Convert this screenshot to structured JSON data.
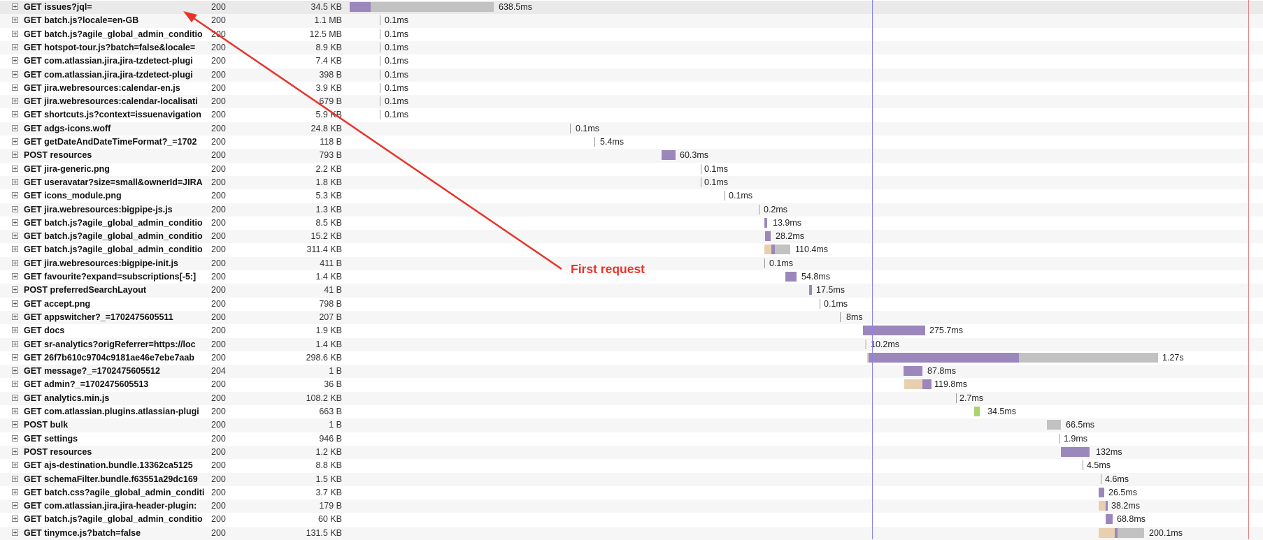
{
  "colors": {
    "waiting": "#9b87bb",
    "receiving": "#c2c2c2",
    "blocked": "#e8cfb0",
    "green": "#a9d36e",
    "dom_line": "#8c84e6",
    "load_line": "#e07a7a",
    "annotation": "#e8332a"
  },
  "annotation": {
    "text": "First request"
  },
  "requests": [
    {
      "url": "GET issues?jql=",
      "status": "200",
      "size": "34.5 KB",
      "time": "638.5ms"
    },
    {
      "url": "GET batch.js?locale=en-GB",
      "status": "200",
      "size": "1.1 MB",
      "time": "0.1ms"
    },
    {
      "url": "GET batch.js?agile_global_admin_conditio",
      "status": "200",
      "size": "12.5 MB",
      "time": "0.1ms"
    },
    {
      "url": "GET hotspot-tour.js?batch=false&locale=",
      "status": "200",
      "size": "8.9 KB",
      "time": "0.1ms"
    },
    {
      "url": "GET com.atlassian.jira.jira-tzdetect-plugi",
      "status": "200",
      "size": "7.4 KB",
      "time": "0.1ms"
    },
    {
      "url": "GET com.atlassian.jira.jira-tzdetect-plugi",
      "status": "200",
      "size": "398 B",
      "time": "0.1ms"
    },
    {
      "url": "GET jira.webresources:calendar-en.js",
      "status": "200",
      "size": "3.9 KB",
      "time": "0.1ms"
    },
    {
      "url": "GET jira.webresources:calendar-localisati",
      "status": "200",
      "size": "679 B",
      "time": "0.1ms"
    },
    {
      "url": "GET shortcuts.js?context=issuenavigation",
      "status": "200",
      "size": "5.9 KB",
      "time": "0.1ms"
    },
    {
      "url": "GET adgs-icons.woff",
      "status": "200",
      "size": "24.8 KB",
      "time": "0.1ms"
    },
    {
      "url": "GET getDateAndDateTimeFormat?_=1702",
      "status": "200",
      "size": "118 B",
      "time": "5.4ms"
    },
    {
      "url": "POST resources",
      "status": "200",
      "size": "793 B",
      "time": "60.3ms"
    },
    {
      "url": "GET jira-generic.png",
      "status": "200",
      "size": "2.2 KB",
      "time": "0.1ms"
    },
    {
      "url": "GET useravatar?size=small&ownerId=JIRA",
      "status": "200",
      "size": "1.8 KB",
      "time": "0.1ms"
    },
    {
      "url": "GET icons_module.png",
      "status": "200",
      "size": "5.3 KB",
      "time": "0.1ms"
    },
    {
      "url": "GET jira.webresources:bigpipe-js.js",
      "status": "200",
      "size": "1.3 KB",
      "time": "0.2ms"
    },
    {
      "url": "GET batch.js?agile_global_admin_conditio",
      "status": "200",
      "size": "8.5 KB",
      "time": "13.9ms"
    },
    {
      "url": "GET batch.js?agile_global_admin_conditio",
      "status": "200",
      "size": "15.2 KB",
      "time": "28.2ms"
    },
    {
      "url": "GET batch.js?agile_global_admin_conditio",
      "status": "200",
      "size": "311.4 KB",
      "time": "110.4ms"
    },
    {
      "url": "GET jira.webresources:bigpipe-init.js",
      "status": "200",
      "size": "411 B",
      "time": "0.1ms"
    },
    {
      "url": "GET favourite?expand=subscriptions[-5:]",
      "status": "200",
      "size": "1.4 KB",
      "time": "54.8ms"
    },
    {
      "url": "POST preferredSearchLayout",
      "status": "200",
      "size": "41 B",
      "time": "17.5ms"
    },
    {
      "url": "GET accept.png",
      "status": "200",
      "size": "798 B",
      "time": "0.1ms"
    },
    {
      "url": "GET appswitcher?_=1702475605511",
      "status": "200",
      "size": "207 B",
      "time": "8ms"
    },
    {
      "url": "GET docs",
      "status": "200",
      "size": "1.9 KB",
      "time": "275.7ms"
    },
    {
      "url": "GET sr-analytics?origReferrer=https://loc",
      "status": "200",
      "size": "1.4 KB",
      "time": "10.2ms"
    },
    {
      "url": "GET 26f7b610c9704c9181ae46e7ebe7aab",
      "status": "200",
      "size": "298.6 KB",
      "time": "1.27s"
    },
    {
      "url": "GET message?_=1702475605512",
      "status": "204",
      "size": "1 B",
      "time": "87.8ms"
    },
    {
      "url": "GET admin?_=1702475605513",
      "status": "200",
      "size": "36 B",
      "time": "119.8ms"
    },
    {
      "url": "GET analytics.min.js",
      "status": "200",
      "size": "108.2 KB",
      "time": "2.7ms"
    },
    {
      "url": "GET com.atlassian.plugins.atlassian-plugi",
      "status": "200",
      "size": "663 B",
      "time": "34.5ms"
    },
    {
      "url": "POST bulk",
      "status": "200",
      "size": "1 B",
      "time": "66.5ms"
    },
    {
      "url": "GET settings",
      "status": "200",
      "size": "946 B",
      "time": "1.9ms"
    },
    {
      "url": "POST resources",
      "status": "200",
      "size": "1.2 KB",
      "time": "132ms"
    },
    {
      "url": "GET ajs-destination.bundle.13362ca5125",
      "status": "200",
      "size": "8.8 KB",
      "time": "4.5ms"
    },
    {
      "url": "GET schemaFilter.bundle.f63551a29dc169",
      "status": "200",
      "size": "1.5 KB",
      "time": "4.6ms"
    },
    {
      "url": "GET batch.css?agile_global_admin_conditi",
      "status": "200",
      "size": "3.7 KB",
      "time": "26.5ms"
    },
    {
      "url": "GET com.atlassian.jira.jira-header-plugin:",
      "status": "200",
      "size": "179 B",
      "time": "38.2ms"
    },
    {
      "url": "GET batch.js?agile_global_admin_conditio",
      "status": "200",
      "size": "60 KB",
      "time": "68.8ms"
    },
    {
      "url": "GET tinymce.js?batch=false",
      "status": "200",
      "size": "131.5 KB",
      "time": "200.1ms"
    }
  ]
}
